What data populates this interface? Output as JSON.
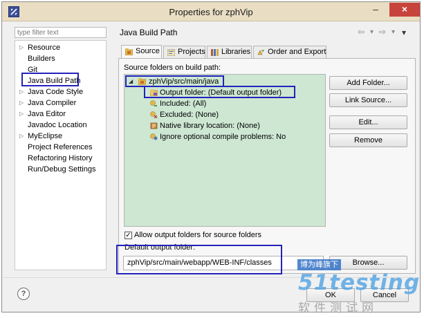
{
  "window": {
    "title": "Properties for zphVip",
    "controls": {
      "minimize": "–",
      "maximize": "□",
      "close": "×"
    }
  },
  "left_panel": {
    "filter_placeholder": "type filter text",
    "items": [
      {
        "label": "Resource",
        "expandable": true
      },
      {
        "label": "Builders",
        "expandable": false
      },
      {
        "label": "Git",
        "expandable": false
      },
      {
        "label": "Java Build Path",
        "expandable": false,
        "selected": true
      },
      {
        "label": "Java Code Style",
        "expandable": true
      },
      {
        "label": "Java Compiler",
        "expandable": true
      },
      {
        "label": "Java Editor",
        "expandable": true
      },
      {
        "label": "Javadoc Location",
        "expandable": false
      },
      {
        "label": "MyEclipse",
        "expandable": true
      },
      {
        "label": "Project References",
        "expandable": false
      },
      {
        "label": "Refactoring History",
        "expandable": false
      },
      {
        "label": "Run/Debug Settings",
        "expandable": false
      }
    ]
  },
  "header": {
    "title": "Java Build Path",
    "nav_icons": [
      "back-arrow-icon",
      "dropdown-icon",
      "forward-arrow-icon",
      "dropdown-icon",
      "view-menu-icon"
    ],
    "nav_glyphs": [
      "⇦",
      "▾",
      "⇨",
      "▾",
      "▾"
    ]
  },
  "tabs": [
    {
      "label": "Source",
      "icon": "source-folder-icon",
      "active": true
    },
    {
      "label": "Projects",
      "icon": "projects-icon",
      "active": false
    },
    {
      "label": "Libraries",
      "icon": "libraries-icon",
      "active": false
    },
    {
      "label": "Order and Export",
      "icon": "order-export-icon",
      "active": false
    }
  ],
  "source": {
    "label": "Source folders on build path:",
    "tree": [
      {
        "label": "zphVip/src/main/java",
        "icon": "package-folder-icon",
        "level": 0,
        "expander": "◢"
      },
      {
        "label": "Output folder: (Default output folder)",
        "icon": "output-folder-icon",
        "level": 1
      },
      {
        "label": "Included: (All)",
        "icon": "included-icon",
        "level": 1
      },
      {
        "label": "Excluded: (None)",
        "icon": "excluded-icon",
        "level": 1
      },
      {
        "label": "Native library location: (None)",
        "icon": "native-library-icon",
        "level": 1
      },
      {
        "label": "Ignore optional compile problems: No",
        "icon": "ignore-problems-icon",
        "level": 1
      }
    ],
    "buttons": {
      "add_folder": "Add Folder...",
      "link_source": "Link Source...",
      "edit": "Edit...",
      "remove": "Remove"
    },
    "allow_output_label": "Allow output folders for source folders",
    "allow_output_checked": true,
    "check_glyph": "✓",
    "default_output_label": "Default output folder:",
    "default_output_value": "zphVip/src/main/webapp/WEB-INF/classes",
    "browse_label": "Browse..."
  },
  "footer": {
    "help": "?",
    "ok_label": "OK",
    "cancel_label": "Cancel"
  },
  "watermark": {
    "tag": "博为峰旗下",
    "logo": "51testing",
    "sub": "软件测试网"
  },
  "colors": {
    "titlebar": "#e9ddc3",
    "source_tree_bg": "#cde7d3",
    "highlight_box": "#2222bb",
    "close_button": "#c7443c"
  }
}
